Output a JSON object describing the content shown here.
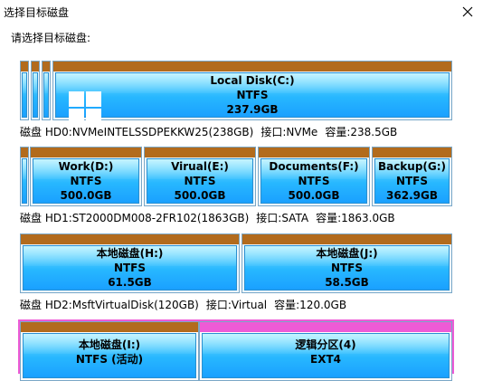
{
  "window": {
    "title": "选择目标磁盘"
  },
  "prompt": "请选择目标磁盘:",
  "disks": [
    {
      "name": "磁盘 HD0:NVMeINTELSSDPEKKW25(238GB)",
      "interface": "接口:NVMe",
      "capacity": "容量:238.5GB",
      "partitions": [
        {
          "name": "Local Disk(C:)",
          "fs": "NTFS",
          "size": "237.9GB"
        }
      ]
    },
    {
      "name": "磁盘 HD1:ST2000DM008-2FR102(1863GB)",
      "interface": "接口:SATA",
      "capacity": "容量:1863.0GB",
      "partitions": [
        {
          "name": "Work(D:)",
          "fs": "NTFS",
          "size": "500.0GB"
        },
        {
          "name": "Virual(E:)",
          "fs": "NTFS",
          "size": "500.0GB"
        },
        {
          "name": "Documents(F:)",
          "fs": "NTFS",
          "size": "500.0GB"
        },
        {
          "name": "Backup(G:)",
          "fs": "NTFS",
          "size": "362.9GB"
        }
      ]
    },
    {
      "name": "磁盘 HD2:MsftVirtualDisk(120GB)",
      "interface": "接口:Virtual",
      "capacity": "容量:120.0GB",
      "partitions": [
        {
          "name": "本地磁盘(H:)",
          "fs": "NTFS",
          "size": "61.5GB"
        },
        {
          "name": "本地磁盘(J:)",
          "fs": "NTFS",
          "size": "58.5GB"
        }
      ]
    },
    {
      "partitions": [
        {
          "name": "本地磁盘(I:)",
          "fs": "NTFS (活动)"
        },
        {
          "name": "逻辑分区(4)",
          "fs": "EXT4"
        }
      ]
    }
  ],
  "colors": {
    "partition_header": "#b26b1d",
    "selected_header": "#ee5bd6",
    "partition_fill": "#27b7ff"
  }
}
